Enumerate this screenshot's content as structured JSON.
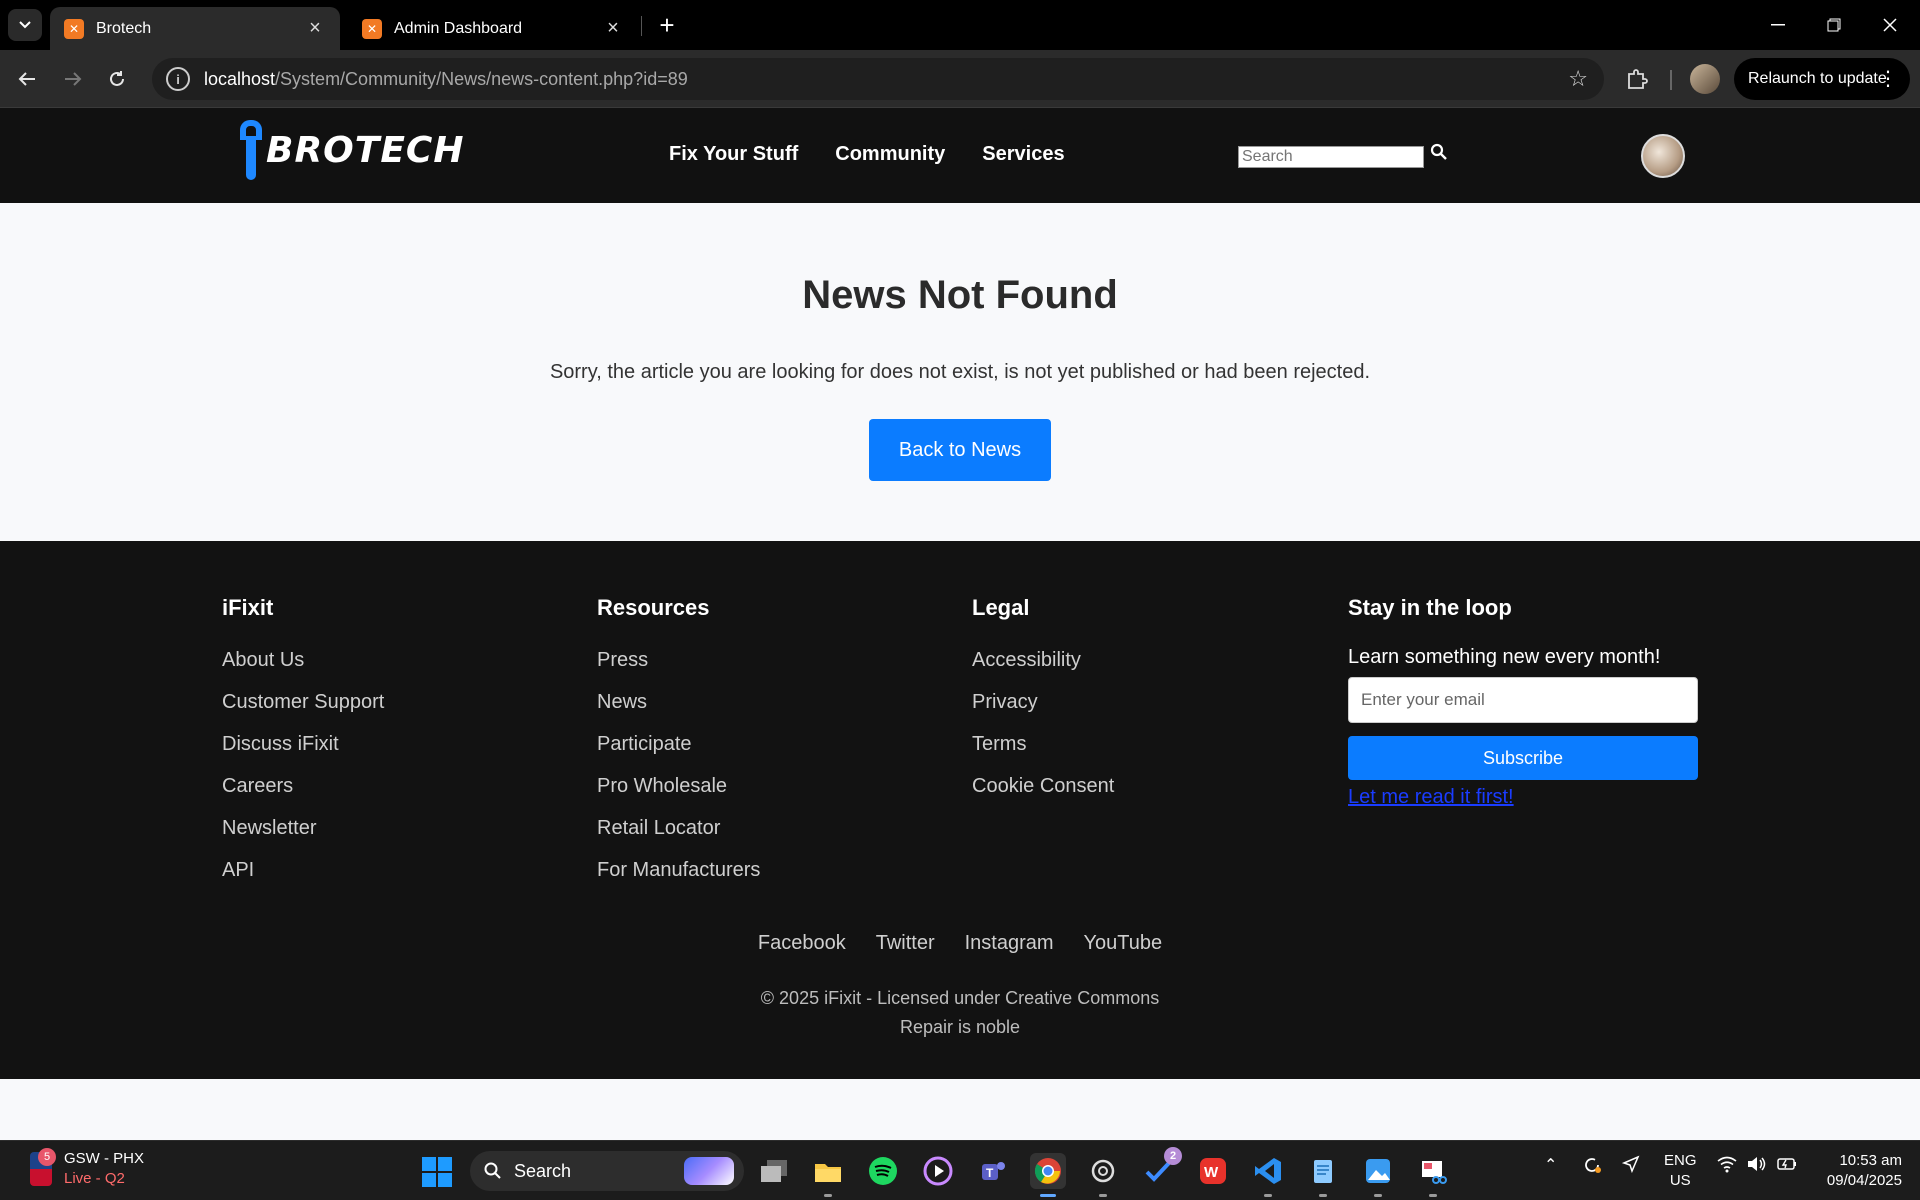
{
  "browser": {
    "tabs": [
      {
        "favicon": "xampp-icon",
        "title": "Brotech",
        "active": true
      },
      {
        "favicon": "xampp-icon",
        "title": "Admin Dashboard",
        "active": false
      }
    ],
    "url_host": "localhost",
    "url_path": "/System/Community/News/news-content.php?id=89",
    "relaunch_label": "Relaunch to update"
  },
  "site": {
    "brand": "BROTECH",
    "nav": [
      "Fix Your Stuff",
      "Community",
      "Services"
    ],
    "search_placeholder": "Search"
  },
  "main": {
    "heading": "News Not Found",
    "message": "Sorry, the article you are looking for does not exist, is not yet published or had been rejected.",
    "back_button": "Back to News"
  },
  "footer": {
    "columns": [
      {
        "title": "iFixit",
        "links": [
          "About Us",
          "Customer Support",
          "Discuss iFixit",
          "Careers",
          "Newsletter",
          "API"
        ]
      },
      {
        "title": "Resources",
        "links": [
          "Press",
          "News",
          "Participate",
          "Pro Wholesale",
          "Retail Locator",
          "For Manufacturers"
        ]
      },
      {
        "title": "Legal",
        "links": [
          "Accessibility",
          "Privacy",
          "Terms",
          "Cookie Consent"
        ]
      }
    ],
    "newsletter": {
      "title": "Stay in the loop",
      "subtitle": "Learn something new every month!",
      "email_placeholder": "Enter your email",
      "subscribe_label": "Subscribe",
      "read_first_label": "Let me read it first!"
    },
    "social": [
      "Facebook",
      "Twitter",
      "Instagram",
      "YouTube"
    ],
    "copyright": "© 2025 iFixit - Licensed under Creative Commons",
    "tagline": "Repair is noble"
  },
  "taskbar": {
    "widget_badge": "5",
    "widget_line1": "GSW - PHX",
    "widget_line2": "Live - Q2",
    "search_label": "Search",
    "todo_badge": "2",
    "lang_line1": "ENG",
    "lang_line2": "US",
    "time": "10:53 am",
    "date": "09/04/2025"
  },
  "colors": {
    "accent": "#0b7cff",
    "header_bg": "#111111",
    "footer_bg": "#121212",
    "page_bg": "#f8f9fb"
  }
}
